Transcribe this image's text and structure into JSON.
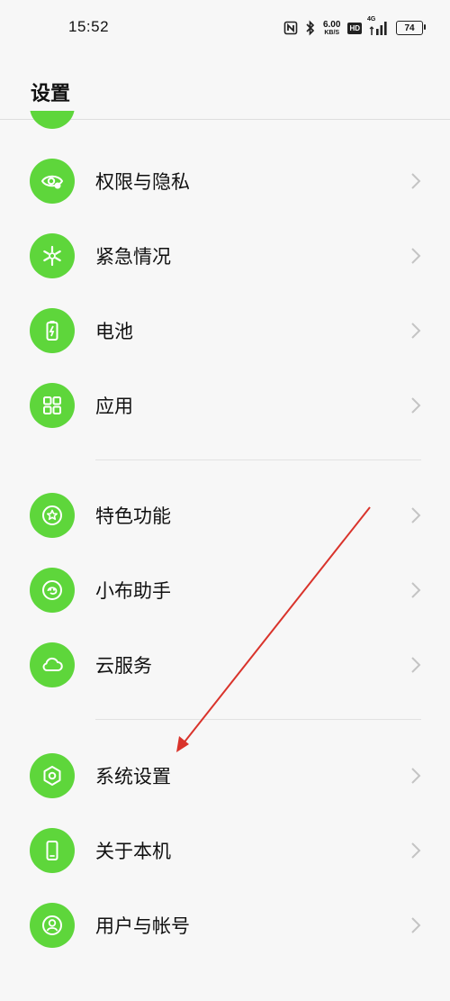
{
  "status_bar": {
    "time": "15:52",
    "speed_value": "6.00",
    "speed_unit": "KB/S",
    "hd_label": "HD",
    "network_label": "4G",
    "battery_level": "74",
    "icons": [
      "nfc-icon",
      "bluetooth-icon",
      "speed-indicator",
      "hd-icon",
      "signal-icon",
      "battery-icon"
    ]
  },
  "header": {
    "title": "设置"
  },
  "settings": {
    "accent_color": "#5ed63b",
    "groups": [
      {
        "items": [
          {
            "label": "权限与隐私",
            "icon": "privacy-eye-icon"
          },
          {
            "label": "紧急情况",
            "icon": "emergency-asterisk-icon"
          },
          {
            "label": "电池",
            "icon": "battery-icon"
          },
          {
            "label": "应用",
            "icon": "apps-grid-icon"
          }
        ]
      },
      {
        "items": [
          {
            "label": "特色功能",
            "icon": "star-circle-icon"
          },
          {
            "label": "小布助手",
            "icon": "assistant-icon"
          },
          {
            "label": "云服务",
            "icon": "cloud-icon"
          }
        ]
      },
      {
        "items": [
          {
            "label": "系统设置",
            "icon": "hexagon-settings-icon"
          },
          {
            "label": "关于本机",
            "icon": "phone-icon"
          },
          {
            "label": "用户与帐号",
            "icon": "user-account-icon"
          }
        ]
      }
    ]
  },
  "annotation": {
    "arrow_color": "#d9332b",
    "points_to": "系统设置"
  }
}
